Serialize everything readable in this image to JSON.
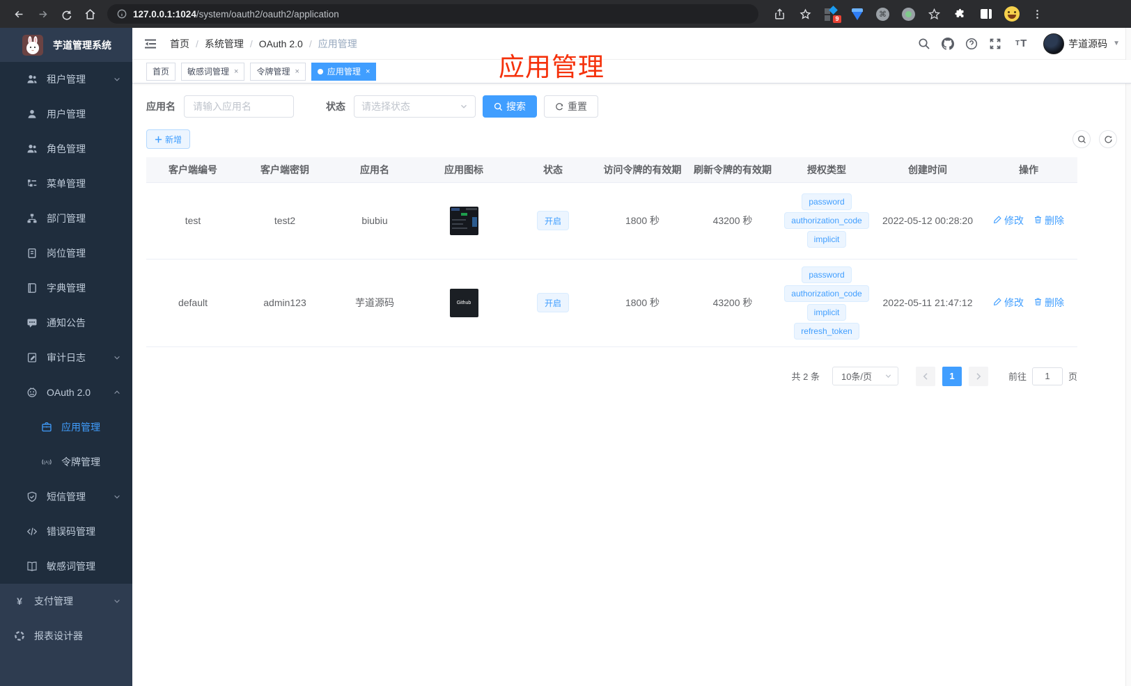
{
  "browser": {
    "url_host": "127.0.0.1:1024",
    "url_path": "/system/oauth2/oauth2/application",
    "extension_badge": "9"
  },
  "sidebar": {
    "logo_title": "芋道管理系统",
    "menu": [
      {
        "label": "租户管理",
        "icon": "users-icon",
        "chevron": "down",
        "section": "sub"
      },
      {
        "label": "用户管理",
        "icon": "user-icon",
        "section": "sub"
      },
      {
        "label": "角色管理",
        "icon": "users-icon",
        "section": "sub"
      },
      {
        "label": "菜单管理",
        "icon": "menu-tree-icon",
        "section": "sub"
      },
      {
        "label": "部门管理",
        "icon": "org-chart-icon",
        "section": "sub"
      },
      {
        "label": "岗位管理",
        "icon": "post-badge-icon",
        "section": "sub"
      },
      {
        "label": "字典管理",
        "icon": "dictionary-icon",
        "section": "sub"
      },
      {
        "label": "通知公告",
        "icon": "announcement-icon",
        "section": "sub"
      },
      {
        "label": "审计日志",
        "icon": "audit-log-icon",
        "chevron": "down",
        "section": "sub"
      },
      {
        "label": "OAuth 2.0",
        "icon": "oauth-robot-icon",
        "chevron": "up",
        "section": "sub"
      },
      {
        "label": "应用管理",
        "icon": "briefcase-icon",
        "section": "nested",
        "active": true
      },
      {
        "label": "令牌管理",
        "icon": "token-icon",
        "section": "nested"
      },
      {
        "label": "短信管理",
        "icon": "shield-check-icon",
        "chevron": "down",
        "section": "sub"
      },
      {
        "label": "错误码管理",
        "icon": "code-icon",
        "section": "sub"
      },
      {
        "label": "敏感词管理",
        "icon": "open-book-icon",
        "section": "sub"
      },
      {
        "label": "支付管理",
        "icon": "yen-icon",
        "chevron": "down",
        "section": "top"
      },
      {
        "label": "报表设计器",
        "icon": "report-designer-icon",
        "section": "top"
      }
    ]
  },
  "header": {
    "breadcrumb": [
      "首页",
      "系统管理",
      "OAuth 2.0",
      "应用管理"
    ],
    "username": "芋道源码"
  },
  "annotation": {
    "text": "应用管理",
    "color": "#f5310b"
  },
  "tabs": [
    {
      "label": "首页",
      "closable": false,
      "active": false
    },
    {
      "label": "敏感词管理",
      "closable": true,
      "active": false
    },
    {
      "label": "令牌管理",
      "closable": true,
      "active": false
    },
    {
      "label": "应用管理",
      "closable": true,
      "active": true
    }
  ],
  "filters": {
    "name_label": "应用名",
    "name_placeholder": "请输入应用名",
    "status_label": "状态",
    "status_placeholder": "请选择状态",
    "search_label": "搜索",
    "reset_label": "重置",
    "add_label": "新增"
  },
  "table": {
    "columns": [
      "客户端编号",
      "客户端密钥",
      "应用名",
      "应用图标",
      "状态",
      "访问令牌的有效期",
      "刷新令牌的有效期",
      "授权类型",
      "创建时间",
      "操作"
    ],
    "actions": {
      "edit": "修改",
      "delete": "删除"
    },
    "rows": [
      {
        "client_id": "test",
        "secret": "test2",
        "name": "biubiu",
        "icon": "dashboard-screenshot",
        "icon_text": "",
        "status": "开启",
        "access_ttl": "1800 秒",
        "refresh_ttl": "43200 秒",
        "grants": [
          "password",
          "authorization_code",
          "implicit"
        ],
        "created": "2022-05-12 00:28:20"
      },
      {
        "client_id": "default",
        "secret": "admin123",
        "name": "芋道源码",
        "icon": "github-dark",
        "icon_text": "Github",
        "status": "开启",
        "access_ttl": "1800 秒",
        "refresh_ttl": "43200 秒",
        "grants": [
          "password",
          "authorization_code",
          "implicit",
          "refresh_token"
        ],
        "created": "2022-05-11 21:47:12"
      }
    ]
  },
  "pagination": {
    "total": "共 2 条",
    "page_size": "10条/页",
    "current": "1",
    "goto_label": "前往",
    "goto_value": "1",
    "page_label": "页"
  },
  "colors": {
    "primary": "#409eff",
    "tag_bg": "#ecf5ff",
    "annotation_red": "#f5310b",
    "sidebar_bg": "#2e3c50",
    "sidebar_submenu_bg": "#1f2d3d"
  }
}
